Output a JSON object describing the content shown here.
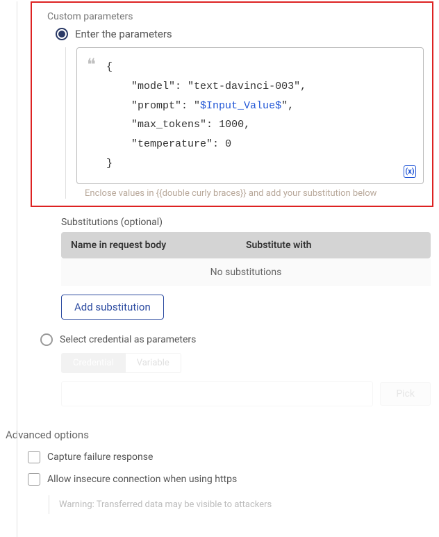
{
  "custom_parameters": {
    "title": "Custom parameters",
    "enter_radio_label": "Enter the parameters",
    "code_json": {
      "model_key": "\"model\"",
      "model_val": "\"text-davinci-003\"",
      "prompt_key": "\"prompt\"",
      "prompt_var": "$Input_Value$",
      "max_tokens_key": "\"max_tokens\"",
      "max_tokens_val": "1000",
      "temperature_key": "\"temperature\"",
      "temperature_val": "0"
    },
    "hint": "Enclose values in {{double curly braces}} and add your substitution below",
    "substitutions": {
      "label": "Substitutions (optional)",
      "col_name": "Name in request body",
      "col_sub": "Substitute with",
      "empty": "No substitutions",
      "add_button": "Add substitution"
    },
    "select_cred_label": "Select credential as parameters",
    "toggle_credential": "Credential",
    "toggle_variable": "Variable",
    "pick_button": "Pick"
  },
  "advanced": {
    "title": "Advanced options",
    "capture_failure": "Capture failure response",
    "allow_insecure": "Allow insecure connection when using https",
    "warning": "Warning: Transferred data may be visible to attackers"
  },
  "chart_data": null
}
